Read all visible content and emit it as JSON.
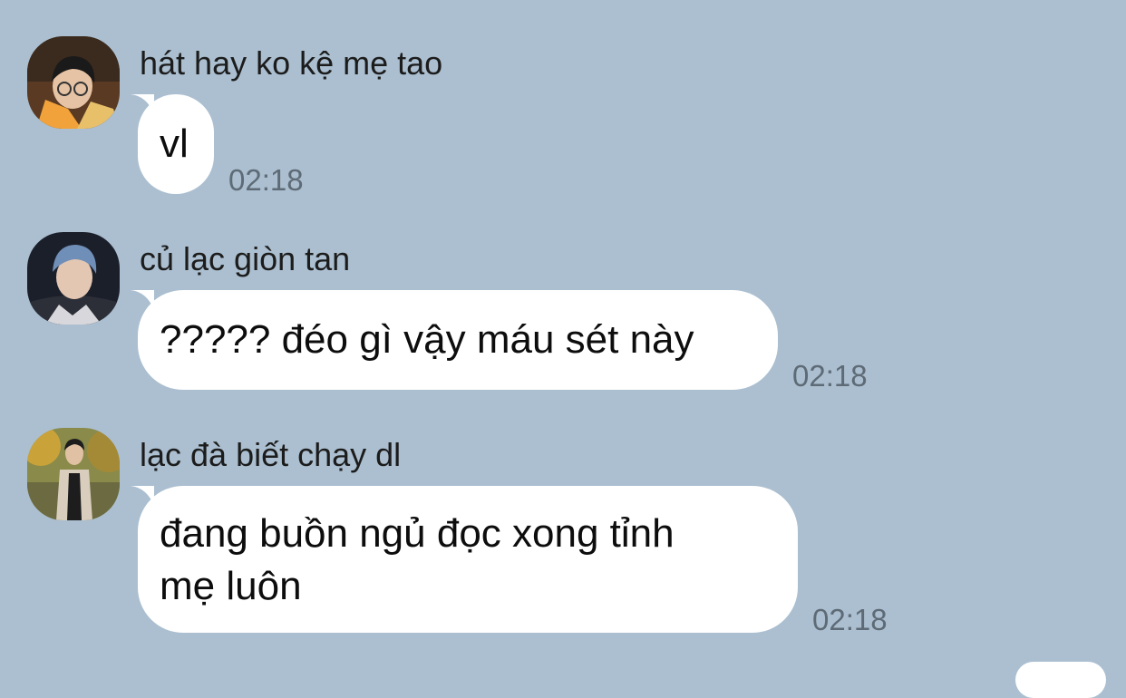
{
  "messages": [
    {
      "sender": "hát hay ko kệ mẹ tao",
      "lines": [
        "vl"
      ],
      "time": "02:18",
      "avatar": "user-avatar-glasses"
    },
    {
      "sender": "củ lạc giòn tan",
      "lines": [
        "????? đéo gì vậy máu sét này"
      ],
      "time": "02:18",
      "avatar": "user-avatar-blue-hair"
    },
    {
      "sender": "lạc đà biết chạy dl",
      "lines": [
        "đang buồn ngủ đọc xong tỉnh",
        "mẹ luôn"
      ],
      "time": "02:18",
      "avatar": "user-avatar-outdoor"
    }
  ],
  "colors": {
    "background": "#abbfd0",
    "bubble": "#ffffff",
    "time": "#5e6b76"
  }
}
